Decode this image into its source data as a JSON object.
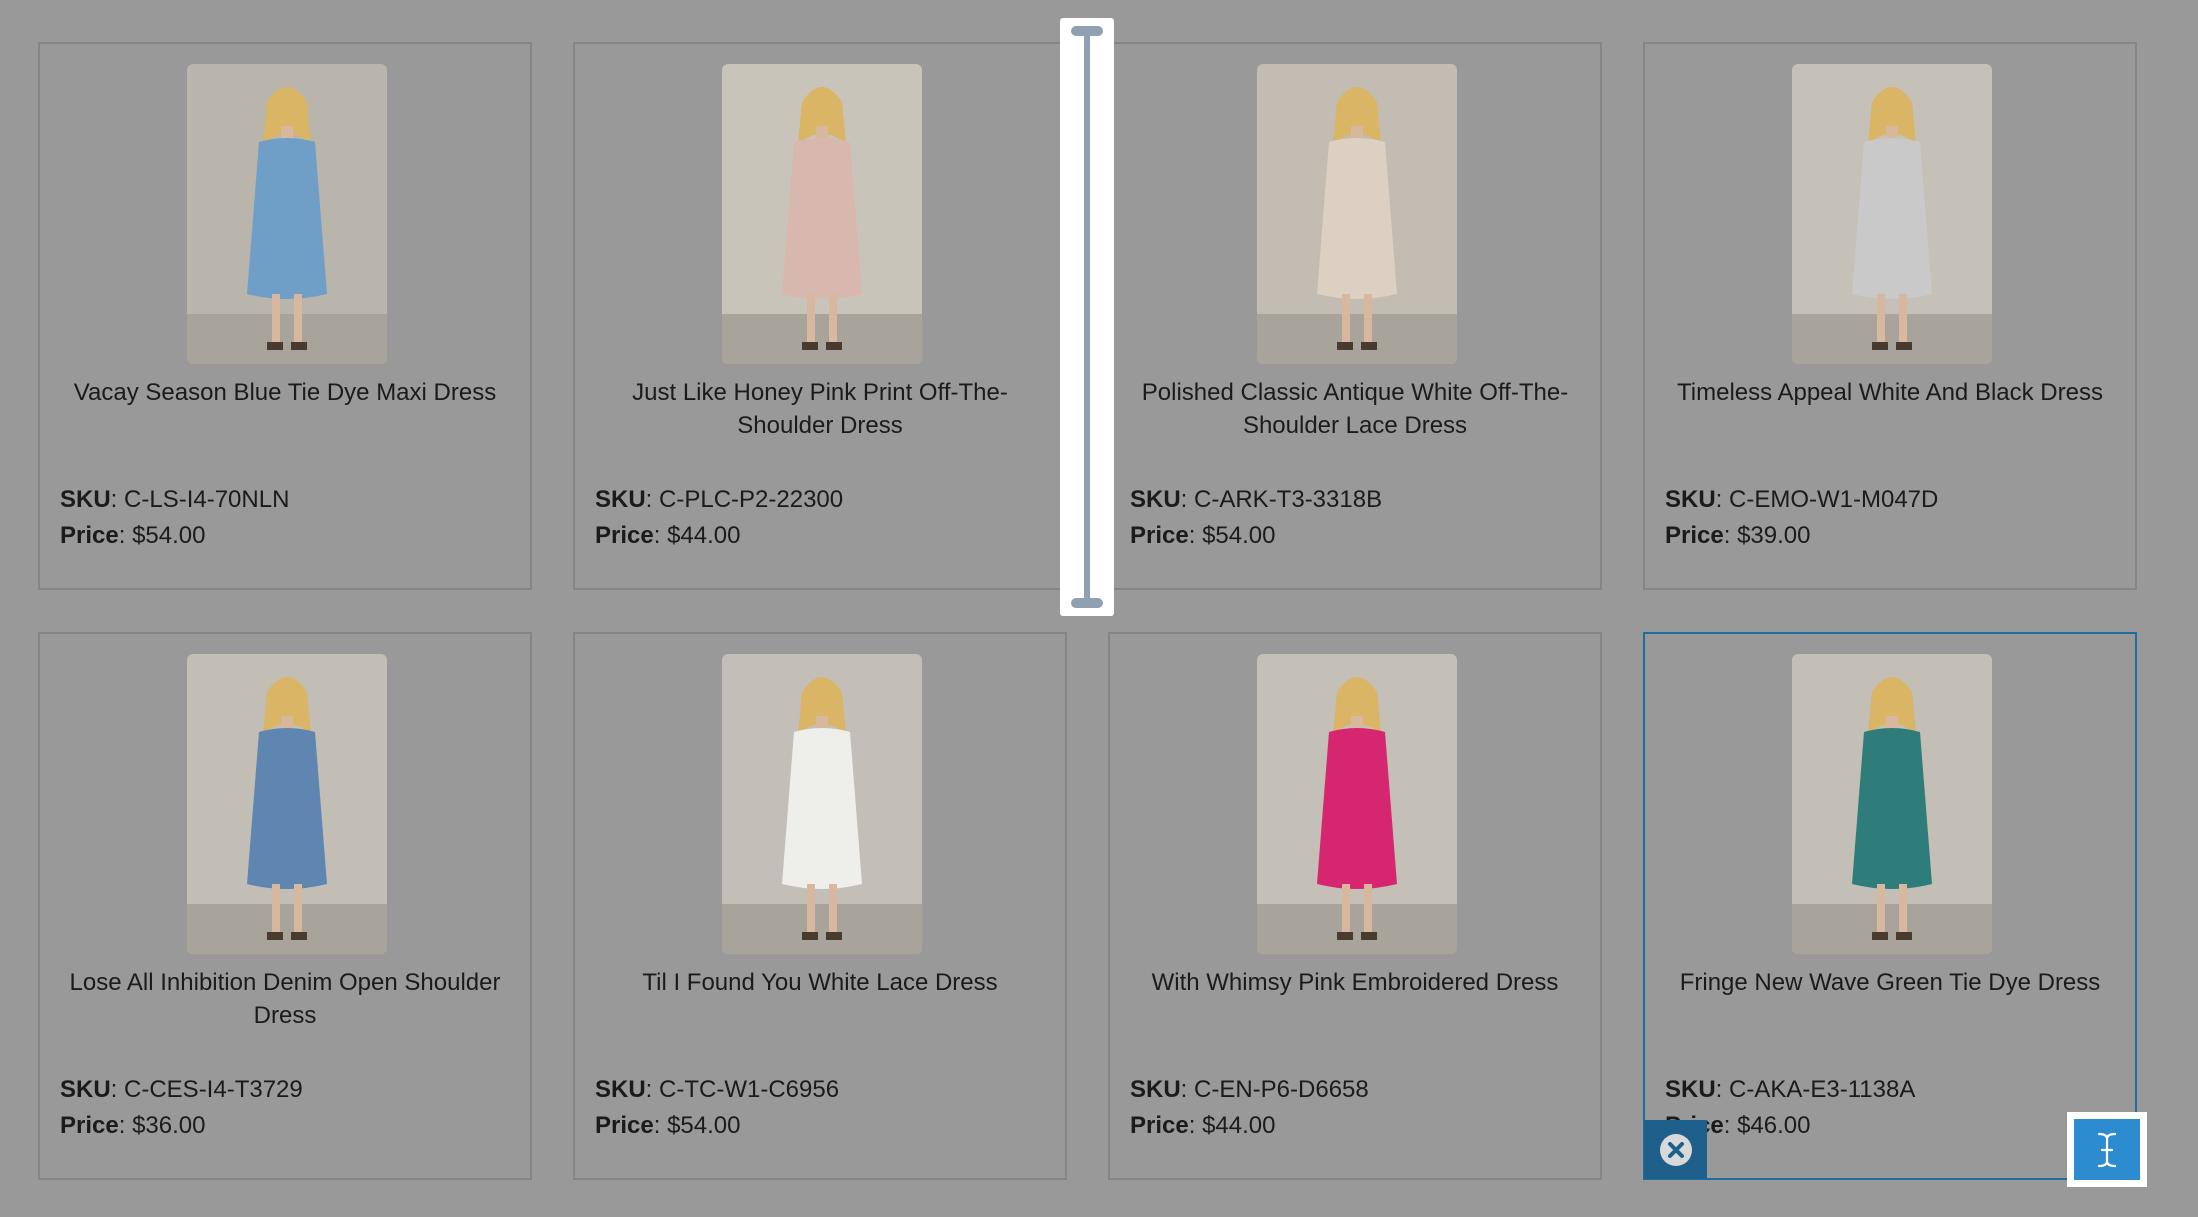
{
  "products": [
    {
      "name": "Vacay Season Blue Tie Dye Maxi Dress",
      "sku_label": "SKU",
      "sku": "C-LS-I4-70NLN",
      "price_label": "Price",
      "price": "$54.00",
      "dress_color": "#6f9fc7",
      "thumb_bg": "#b9b4ac"
    },
    {
      "name": "Just Like Honey Pink Print Off-The-Shoulder Dress",
      "sku_label": "SKU",
      "sku": "C-PLC-P2-22300",
      "price_label": "Price",
      "price": "$44.00",
      "dress_color": "#d8b7ae",
      "thumb_bg": "#c9c4ba"
    },
    {
      "name": "Polished Classic Antique White Off-The-Shoulder Lace Dress",
      "sku_label": "SKU",
      "sku": "C-ARK-T3-3318B",
      "price_label": "Price",
      "price": "$54.00",
      "dress_color": "#dcd0c2",
      "thumb_bg": "#c2bcb2"
    },
    {
      "name": "Timeless Appeal White And Black Dress",
      "sku_label": "SKU",
      "sku": "C-EMO-W1-M047D",
      "price_label": "Price",
      "price": "$39.00",
      "dress_color": "#c9c9c9",
      "thumb_bg": "#c5c0b8"
    },
    {
      "name": "Lose All Inhibition Denim Open Shoulder Dress",
      "sku_label": "SKU",
      "sku": "C-CES-I4-T3729",
      "price_label": "Price",
      "price": "$36.00",
      "dress_color": "#5f86b1",
      "thumb_bg": "#c2beb6"
    },
    {
      "name": "Til I Found You White Lace Dress",
      "sku_label": "SKU",
      "sku": "C-TC-W1-C6956",
      "price_label": "Price",
      "price": "$54.00",
      "dress_color": "#eeeeea",
      "thumb_bg": "#c3bfb8"
    },
    {
      "name": "With Whimsy Pink Embroidered Dress",
      "sku_label": "SKU",
      "sku": "C-EN-P6-D6658",
      "price_label": "Price",
      "price": "$44.00",
      "dress_color": "#d6266f",
      "thumb_bg": "#c4bfb7"
    },
    {
      "name": "Fringe New Wave Green Tie Dye Dress",
      "sku_label": "SKU",
      "sku": "C-AKA-E3-1138A",
      "price_label": "Price",
      "price": "$46.00",
      "dress_color": "#2f7d7a",
      "thumb_bg": "#c3beb6"
    }
  ],
  "overlay": {
    "column_handle_icon": "ibeam-handle-icon",
    "close_icon": "close-icon",
    "text_cursor_icon": "text-cursor-icon",
    "accent": "#2d8bd0",
    "close_bg": "#1f5f8c",
    "selected_border": "#1f6c9e"
  }
}
